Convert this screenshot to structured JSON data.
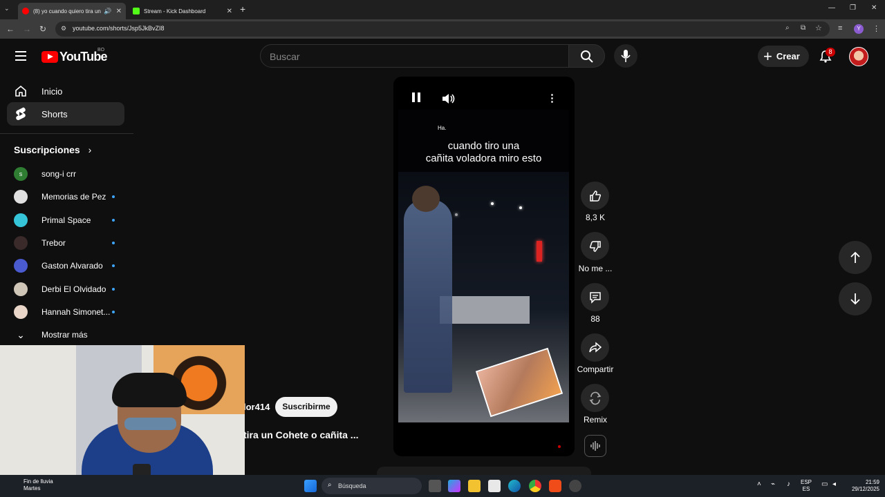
{
  "browser": {
    "tabs": [
      {
        "title": "(8) yo cuando quiero tira un",
        "active": true
      },
      {
        "title": "Stream - Kick Dashboard",
        "active": false
      }
    ],
    "url": "youtube.com/shorts/Jsp5JkBvZI8",
    "profile_initial": "Y"
  },
  "masthead": {
    "logo_text": "YouTube",
    "country_code": "BO",
    "search_placeholder": "Buscar",
    "create_label": "Crear",
    "notifications_count": "8"
  },
  "sidebar": {
    "items": [
      {
        "label": "Inicio",
        "icon": "home-icon"
      },
      {
        "label": "Shorts",
        "icon": "shorts-icon",
        "active": true
      }
    ],
    "subscriptions_heading": "Suscripciones",
    "subscriptions": [
      {
        "name": "song-i crr",
        "avatar_color": "#2e7d32",
        "avatar_letter": "s",
        "new": false
      },
      {
        "name": "Memorias de Pez",
        "avatar_color": "#e0e0e0",
        "new": true
      },
      {
        "name": "Primal Space",
        "avatar_color": "#35c4d8",
        "new": true
      },
      {
        "name": "Trebor",
        "avatar_color": "#3a2a2a",
        "new": true
      },
      {
        "name": "Gaston Alvarado",
        "avatar_color": "#4a5bd0",
        "new": true
      },
      {
        "name": "Derbi El Olvidado",
        "avatar_color": "#cfc6b8",
        "new": true
      },
      {
        "name": "Hannah Simonet...",
        "avatar_color": "#e9d6c8",
        "new": true
      }
    ],
    "show_more": "Mostrar más"
  },
  "short": {
    "overlay_small_text": "Ha.",
    "caption_line1": "cuando tiro una",
    "caption_line2": "cañita voladora miro esto",
    "channel": "lor414",
    "subscribe_label": "Suscribirme",
    "title": "tira un Cohete o cañita ..."
  },
  "actions": {
    "like_count": "8,3 K",
    "dislike_label": "No me ...",
    "comments_count": "88",
    "share_label": "Compartir",
    "remix_label": "Remix"
  },
  "taskbar": {
    "weather_line1": "Fin de lluvia",
    "weather_line2": "Martes",
    "search_label": "Búsqueda",
    "lang_line1": "ESP",
    "lang_line2": "ES",
    "time": "21:59",
    "date": "29/12/2025"
  },
  "colors": {
    "background": "#0f0f0f",
    "accent_red": "#ff0000",
    "surface": "#272727",
    "new_dot": "#3ea6ff"
  }
}
